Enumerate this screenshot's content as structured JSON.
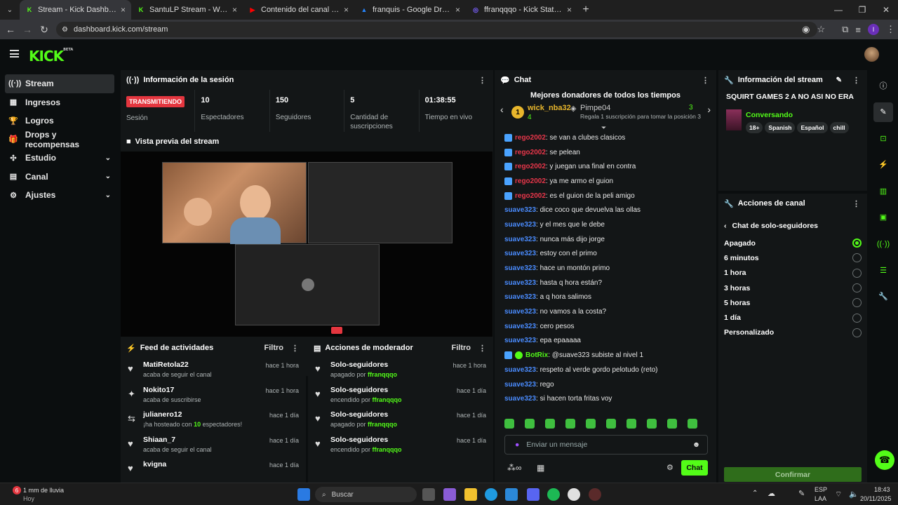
{
  "browser": {
    "tabs": [
      {
        "title": "Stream - Kick Dashboard",
        "color": "#53fc18",
        "glyph": "K"
      },
      {
        "title": "SantuLP Stream - Watch Live on Kick",
        "color": "#53fc18",
        "glyph": "K"
      },
      {
        "title": "Contenido del canal - YouTube Studio",
        "color": "#ff0000",
        "glyph": "▶"
      },
      {
        "title": "franquis - Google Drive",
        "color": "#2684fc",
        "glyph": "▲"
      },
      {
        "title": "ffranqqqo - Kick Stats, Analytics",
        "color": "#7b61ff",
        "glyph": "◎"
      }
    ],
    "url": "dashboard.kick.com/stream",
    "profile_letter": "I"
  },
  "sidebar": {
    "items": [
      {
        "label": "Stream",
        "icon": "((·))",
        "chev": ""
      },
      {
        "label": "Ingresos",
        "icon": "▦",
        "chev": ""
      },
      {
        "label": "Logros",
        "icon": "🏆",
        "chev": ""
      },
      {
        "label": "Drops y recompensas",
        "icon": "🎁",
        "chev": ""
      },
      {
        "label": "Estudio",
        "icon": "✣",
        "chev": "⌄"
      },
      {
        "label": "Canal",
        "icon": "▤",
        "chev": "⌄"
      },
      {
        "label": "Ajustes",
        "icon": "⚙",
        "chev": "⌄"
      }
    ]
  },
  "session": {
    "title": "Información de la sesión",
    "badge": "TRANSMITIENDO",
    "badge_label": "Sesión",
    "stats": [
      {
        "value": "10",
        "label": "Espectadores"
      },
      {
        "value": "150",
        "label": "Seguidores"
      },
      {
        "value": "5",
        "label": "Cantidad de suscripciones"
      },
      {
        "value": "01:38:55",
        "label": "Tiempo en vivo"
      }
    ]
  },
  "preview": {
    "title": "Vista previa del stream"
  },
  "feed": {
    "title": "Feed de actividades",
    "filter": "Filtro",
    "rows": [
      {
        "icon": "♥",
        "name": "MatiRetola22",
        "sub": "acaba de seguir el canal",
        "time": "hace 1 hora"
      },
      {
        "icon": "✦",
        "name": "Nokito17",
        "sub": "acaba de suscribirse",
        "time": "hace 1 hora"
      },
      {
        "icon": "⇆",
        "name": "julianero12",
        "sub_pre": "¡ha hosteado con ",
        "sub_num": "10",
        "sub_post": " espectadores!",
        "time": "hace 1 día"
      },
      {
        "icon": "♥",
        "name": "Shiaan_7",
        "sub": "acaba de seguir el canal",
        "time": "hace 1 día"
      },
      {
        "icon": "♥",
        "name": "kvigna",
        "sub": "",
        "time": "hace 1 día"
      }
    ]
  },
  "mod": {
    "title": "Acciones de moderador",
    "filter": "Filtro",
    "rows": [
      {
        "name": "Solo-seguidores",
        "state": "apagado por ",
        "by": "ffranqqqo",
        "time": "hace 1 hora"
      },
      {
        "name": "Solo-seguidores",
        "state": "encendido por ",
        "by": "ffranqqqo",
        "time": "hace 1 día"
      },
      {
        "name": "Solo-seguidores",
        "state": "apagado por ",
        "by": "ffranqqqo",
        "time": "hace 1 día"
      },
      {
        "name": "Solo-seguidores",
        "state": "encendido por ",
        "by": "ffranqqqo",
        "time": "hace 1 día"
      }
    ]
  },
  "chat": {
    "title": "Chat",
    "donors_title": "Mejores donadores de todos los tiempos",
    "donor1": {
      "name": "wick_nba32",
      "rank": "1",
      "count": "4"
    },
    "donor2": {
      "name": "Pimpe04",
      "count": "3",
      "hint": "Regala 1 suscripción para tomar la posición 3"
    },
    "messages": [
      {
        "user": "rego2002",
        "color": "#e8364a",
        "text": ": se van a clubes clasicos",
        "badge": true
      },
      {
        "user": "rego2002",
        "color": "#e8364a",
        "text": ": se pelean",
        "badge": true
      },
      {
        "user": "rego2002",
        "color": "#e8364a",
        "text": ": y juegan una final en contra",
        "badge": true
      },
      {
        "user": "rego2002",
        "color": "#e8364a",
        "text": ": ya me armo el guion",
        "badge": true
      },
      {
        "user": "rego2002",
        "color": "#e8364a",
        "text": ": es el guion de la peli amigo",
        "badge": true
      },
      {
        "user": "suave323",
        "color": "#4a8cff",
        "text": ": dice coco que devuelva las ollas",
        "badge": false
      },
      {
        "user": "suave323",
        "color": "#4a8cff",
        "text": ": y el mes que le debe",
        "badge": false
      },
      {
        "user": "suave323",
        "color": "#4a8cff",
        "text": ": nunca más dijo jorge",
        "badge": false
      },
      {
        "user": "suave323",
        "color": "#4a8cff",
        "text": ": estoy con el primo",
        "badge": false
      },
      {
        "user": "suave323",
        "color": "#4a8cff",
        "text": ": hace un montón primo",
        "badge": false
      },
      {
        "user": "suave323",
        "color": "#4a8cff",
        "text": ": hasta q hora están?",
        "badge": false
      },
      {
        "user": "suave323",
        "color": "#4a8cff",
        "text": ": a q hora salimos",
        "badge": false
      },
      {
        "user": "suave323",
        "color": "#4a8cff",
        "text": ": no vamos a la costa?",
        "badge": false
      },
      {
        "user": "suave323",
        "color": "#4a8cff",
        "text": ": cero pesos",
        "badge": false
      },
      {
        "user": "suave323",
        "color": "#4a8cff",
        "text": ": epa epaaaaa",
        "badge": false
      },
      {
        "user": "BotRix",
        "color": "#53fc18",
        "text": ": @suave323 subiste al nivel 1",
        "badge": true,
        "bot": true
      },
      {
        "user": "suave323",
        "color": "#4a8cff",
        "text": ": respeto al verde gordo pelotudo (reto)",
        "badge": false
      },
      {
        "user": "suave323",
        "color": "#4a8cff",
        "text": ": rego",
        "badge": false
      },
      {
        "user": "suave323",
        "color": "#4a8cff",
        "text": ": si hacen torta fritas voy",
        "badge": false
      }
    ],
    "placeholder": "Enviar un mensaje",
    "send_label": "Chat"
  },
  "stream_info": {
    "title": "Información del stream",
    "stream_title": "SQUIRT GAMES 2 A NO ASI NO ERA",
    "category": "Conversando",
    "tags": [
      "18+",
      "Spanish",
      "Español",
      "chill"
    ]
  },
  "channel_actions": {
    "title": "Acciones de canal",
    "sub_title": "Chat de solo-seguidores",
    "options": [
      {
        "label": "Apagado",
        "selected": true
      },
      {
        "label": "6 minutos",
        "selected": false
      },
      {
        "label": "1 hora",
        "selected": false
      },
      {
        "label": "3 horas",
        "selected": false
      },
      {
        "label": "5 horas",
        "selected": false
      },
      {
        "label": "1 día",
        "selected": false
      },
      {
        "label": "Personalizado",
        "selected": false
      }
    ],
    "confirm": "Confirmar"
  },
  "taskbar": {
    "weather_count": "6",
    "weather": "1 mm de lluvia",
    "weather_sub": "Hoy",
    "search": "Buscar",
    "lang1": "ESP",
    "lang2": "LAA",
    "time": "18:43",
    "date": "20/11/2025"
  },
  "colors": {
    "accent": "#53fc18",
    "live": "#e4363f"
  }
}
